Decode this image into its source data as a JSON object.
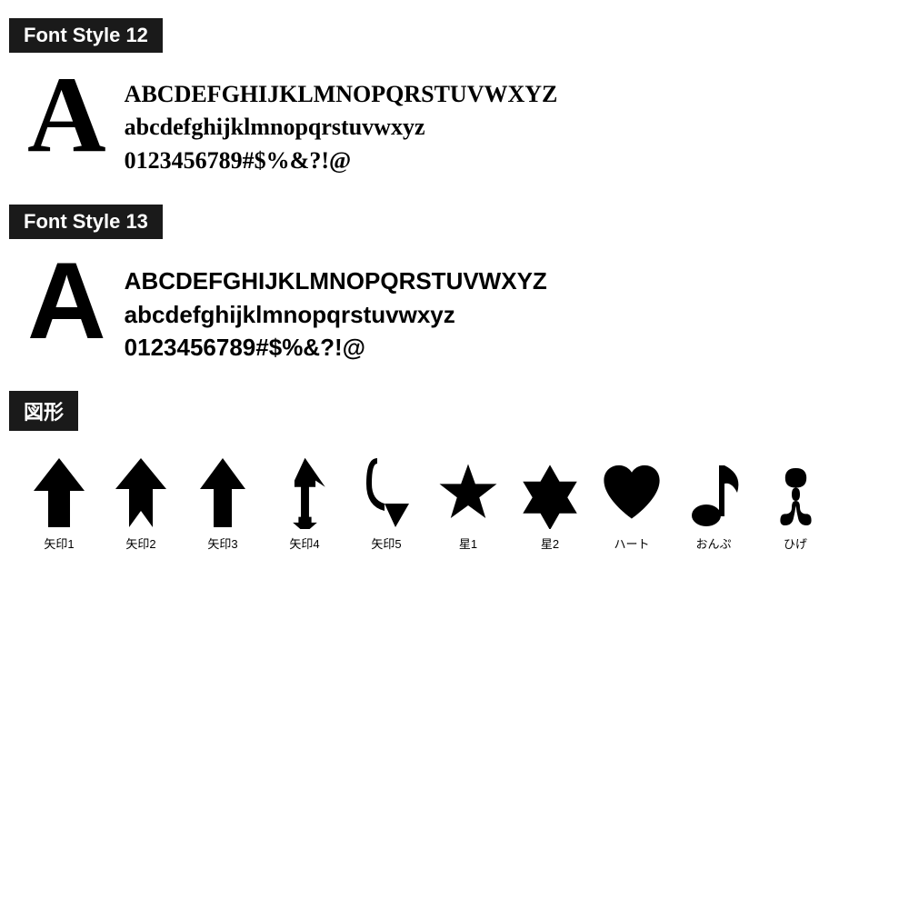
{
  "font_style_12": {
    "label": "Font Style 12",
    "big_letter": "A",
    "lines": [
      "ABCDEFGHIJKLMNOPQRSTUVWXYZ",
      "abcdefghijklmnopqrstuvwxyz",
      "0123456789#$%&?!@"
    ]
  },
  "font_style_13": {
    "label": "Font Style 13",
    "big_letter": "A",
    "lines": [
      "ABCDEFGHIJKLMNOPQRSTUVWXYZ",
      "abcdefghijklmnopqrstuvwxyz",
      "0123456789#$%&?!@"
    ]
  },
  "shapes": {
    "label": "図形",
    "items": [
      {
        "name": "矢印1"
      },
      {
        "name": "矢印2"
      },
      {
        "name": "矢印3"
      },
      {
        "name": "矢印4"
      },
      {
        "name": "矢印5"
      },
      {
        "name": "星1"
      },
      {
        "name": "星2"
      },
      {
        "name": "ハート"
      },
      {
        "name": "おんぷ"
      },
      {
        "name": "ひげ"
      }
    ]
  }
}
